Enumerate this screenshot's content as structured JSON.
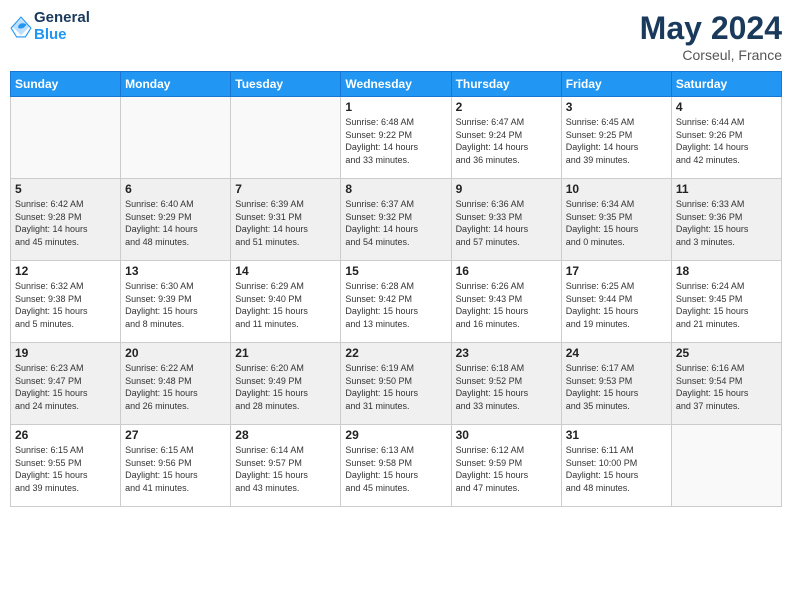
{
  "header": {
    "logo_line1": "General",
    "logo_line2": "Blue",
    "month": "May 2024",
    "location": "Corseul, France"
  },
  "days_of_week": [
    "Sunday",
    "Monday",
    "Tuesday",
    "Wednesday",
    "Thursday",
    "Friday",
    "Saturday"
  ],
  "weeks": [
    [
      {
        "day": "",
        "info": ""
      },
      {
        "day": "",
        "info": ""
      },
      {
        "day": "",
        "info": ""
      },
      {
        "day": "1",
        "info": "Sunrise: 6:48 AM\nSunset: 9:22 PM\nDaylight: 14 hours\nand 33 minutes."
      },
      {
        "day": "2",
        "info": "Sunrise: 6:47 AM\nSunset: 9:24 PM\nDaylight: 14 hours\nand 36 minutes."
      },
      {
        "day": "3",
        "info": "Sunrise: 6:45 AM\nSunset: 9:25 PM\nDaylight: 14 hours\nand 39 minutes."
      },
      {
        "day": "4",
        "info": "Sunrise: 6:44 AM\nSunset: 9:26 PM\nDaylight: 14 hours\nand 42 minutes."
      }
    ],
    [
      {
        "day": "5",
        "info": "Sunrise: 6:42 AM\nSunset: 9:28 PM\nDaylight: 14 hours\nand 45 minutes."
      },
      {
        "day": "6",
        "info": "Sunrise: 6:40 AM\nSunset: 9:29 PM\nDaylight: 14 hours\nand 48 minutes."
      },
      {
        "day": "7",
        "info": "Sunrise: 6:39 AM\nSunset: 9:31 PM\nDaylight: 14 hours\nand 51 minutes."
      },
      {
        "day": "8",
        "info": "Sunrise: 6:37 AM\nSunset: 9:32 PM\nDaylight: 14 hours\nand 54 minutes."
      },
      {
        "day": "9",
        "info": "Sunrise: 6:36 AM\nSunset: 9:33 PM\nDaylight: 14 hours\nand 57 minutes."
      },
      {
        "day": "10",
        "info": "Sunrise: 6:34 AM\nSunset: 9:35 PM\nDaylight: 15 hours\nand 0 minutes."
      },
      {
        "day": "11",
        "info": "Sunrise: 6:33 AM\nSunset: 9:36 PM\nDaylight: 15 hours\nand 3 minutes."
      }
    ],
    [
      {
        "day": "12",
        "info": "Sunrise: 6:32 AM\nSunset: 9:38 PM\nDaylight: 15 hours\nand 5 minutes."
      },
      {
        "day": "13",
        "info": "Sunrise: 6:30 AM\nSunset: 9:39 PM\nDaylight: 15 hours\nand 8 minutes."
      },
      {
        "day": "14",
        "info": "Sunrise: 6:29 AM\nSunset: 9:40 PM\nDaylight: 15 hours\nand 11 minutes."
      },
      {
        "day": "15",
        "info": "Sunrise: 6:28 AM\nSunset: 9:42 PM\nDaylight: 15 hours\nand 13 minutes."
      },
      {
        "day": "16",
        "info": "Sunrise: 6:26 AM\nSunset: 9:43 PM\nDaylight: 15 hours\nand 16 minutes."
      },
      {
        "day": "17",
        "info": "Sunrise: 6:25 AM\nSunset: 9:44 PM\nDaylight: 15 hours\nand 19 minutes."
      },
      {
        "day": "18",
        "info": "Sunrise: 6:24 AM\nSunset: 9:45 PM\nDaylight: 15 hours\nand 21 minutes."
      }
    ],
    [
      {
        "day": "19",
        "info": "Sunrise: 6:23 AM\nSunset: 9:47 PM\nDaylight: 15 hours\nand 24 minutes."
      },
      {
        "day": "20",
        "info": "Sunrise: 6:22 AM\nSunset: 9:48 PM\nDaylight: 15 hours\nand 26 minutes."
      },
      {
        "day": "21",
        "info": "Sunrise: 6:20 AM\nSunset: 9:49 PM\nDaylight: 15 hours\nand 28 minutes."
      },
      {
        "day": "22",
        "info": "Sunrise: 6:19 AM\nSunset: 9:50 PM\nDaylight: 15 hours\nand 31 minutes."
      },
      {
        "day": "23",
        "info": "Sunrise: 6:18 AM\nSunset: 9:52 PM\nDaylight: 15 hours\nand 33 minutes."
      },
      {
        "day": "24",
        "info": "Sunrise: 6:17 AM\nSunset: 9:53 PM\nDaylight: 15 hours\nand 35 minutes."
      },
      {
        "day": "25",
        "info": "Sunrise: 6:16 AM\nSunset: 9:54 PM\nDaylight: 15 hours\nand 37 minutes."
      }
    ],
    [
      {
        "day": "26",
        "info": "Sunrise: 6:15 AM\nSunset: 9:55 PM\nDaylight: 15 hours\nand 39 minutes."
      },
      {
        "day": "27",
        "info": "Sunrise: 6:15 AM\nSunset: 9:56 PM\nDaylight: 15 hours\nand 41 minutes."
      },
      {
        "day": "28",
        "info": "Sunrise: 6:14 AM\nSunset: 9:57 PM\nDaylight: 15 hours\nand 43 minutes."
      },
      {
        "day": "29",
        "info": "Sunrise: 6:13 AM\nSunset: 9:58 PM\nDaylight: 15 hours\nand 45 minutes."
      },
      {
        "day": "30",
        "info": "Sunrise: 6:12 AM\nSunset: 9:59 PM\nDaylight: 15 hours\nand 47 minutes."
      },
      {
        "day": "31",
        "info": "Sunrise: 6:11 AM\nSunset: 10:00 PM\nDaylight: 15 hours\nand 48 minutes."
      },
      {
        "day": "",
        "info": ""
      }
    ]
  ]
}
